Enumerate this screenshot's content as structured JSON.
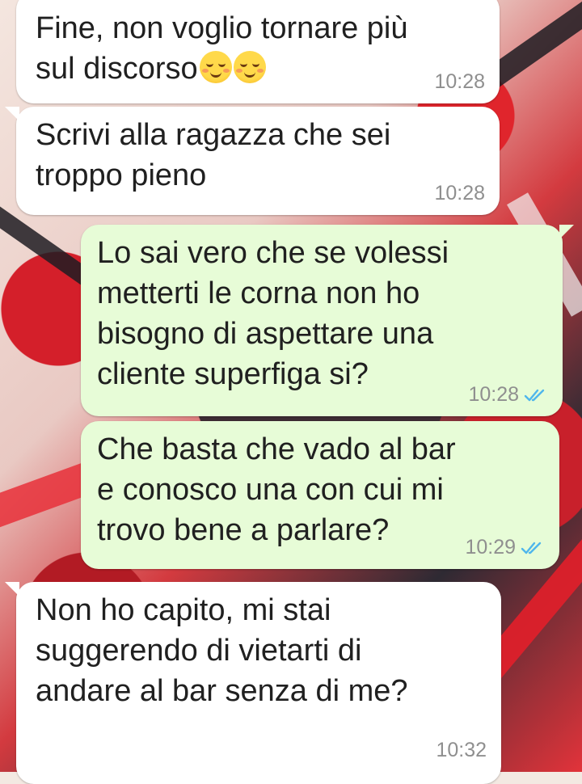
{
  "chat": {
    "messages": [
      {
        "direction": "in",
        "text": "Fine, non voglio tornare più\nsul discorso",
        "emojis": [
          "relieved-smiling-face-emoji",
          "relieved-smiling-face-emoji"
        ],
        "time": "10:28"
      },
      {
        "direction": "in",
        "text": "Scrivi alla ragazza che sei\ntroppo pieno",
        "time": "10:28"
      },
      {
        "direction": "out",
        "text": "Lo sai vero che se volessi\nmetterti le corna non ho\nbisogno di aspettare una\ncliente superfiga si?",
        "time": "10:28",
        "status": "read"
      },
      {
        "direction": "out",
        "text": "Che basta che vado al bar\ne conosco una con cui mi\ntrovo bene a parlare?",
        "time": "10:29",
        "status": "read"
      },
      {
        "direction": "in",
        "text": "Non ho capito, mi stai\nsuggerendo di vietarti di\nandare al bar senza di me?",
        "time": "10:32"
      }
    ]
  },
  "colors": {
    "incoming_bubble": "#ffffff",
    "outgoing_bubble": "#e7fcd7",
    "read_ticks": "#4fb6ec",
    "timestamp": "#8f8f8f"
  },
  "icons": {
    "read_status": "double-check-icon"
  }
}
